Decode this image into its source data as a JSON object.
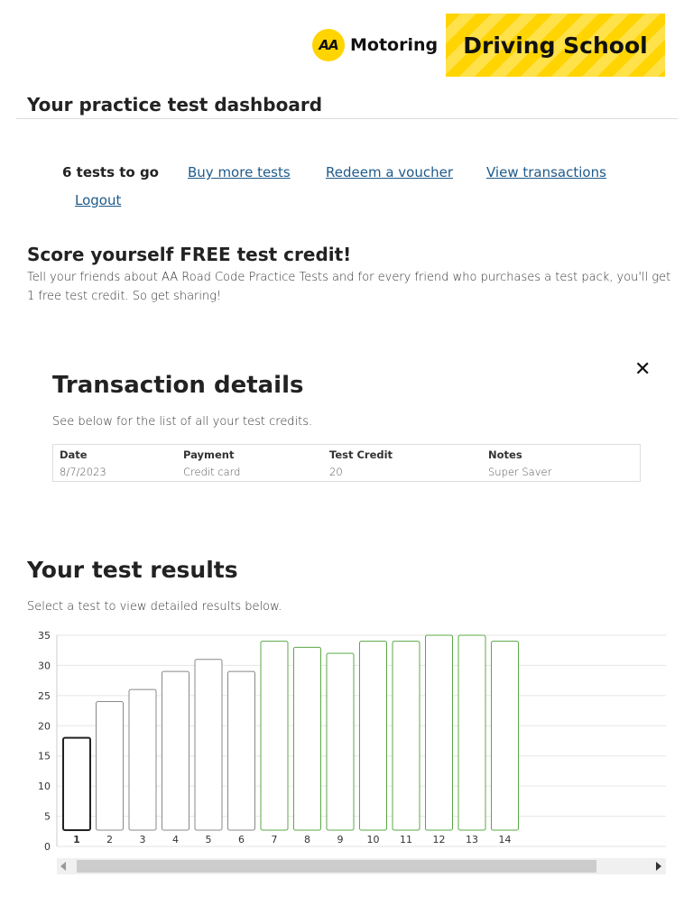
{
  "header": {
    "aa_badge": "AA",
    "aa_word": "Motoring",
    "banner": "Driving School",
    "brand_yellow": "#ffd400"
  },
  "dashboard": {
    "title": "Your practice test dashboard",
    "tests_left": "6 tests to go",
    "links": {
      "buy": "Buy more tests",
      "redeem": "Redeem a voucher",
      "transactions": "View transactions",
      "logout": "Logout"
    }
  },
  "credit": {
    "title": "Score yourself FREE test credit!",
    "description": "Tell your friends about AA Road Code Practice Tests and for every friend who purchases a test pack, you'll get 1 free test credit. So get sharing!"
  },
  "transactions": {
    "title": "Transaction details",
    "close_icon": "close-icon",
    "description": "See below for the list of all your test credits.",
    "columns": [
      "Date",
      "Payment",
      "Test Credit",
      "Notes"
    ],
    "rows": [
      [
        "8/7/2023",
        "Credit card",
        "20",
        "Super Saver"
      ]
    ]
  },
  "results": {
    "title": "Your test results",
    "description": "Select a test to view detailed results below."
  },
  "chart_data": {
    "type": "bar",
    "categories": [
      "1",
      "2",
      "3",
      "4",
      "5",
      "6",
      "7",
      "8",
      "9",
      "10",
      "11",
      "12",
      "13",
      "14"
    ],
    "values": [
      18,
      24,
      26,
      29,
      31,
      29,
      34,
      33,
      32,
      34,
      34,
      35,
      35,
      34
    ],
    "pass_threshold": 32,
    "selected_index": 0,
    "ylim": [
      0,
      35
    ],
    "yticks": [
      0,
      5,
      10,
      15,
      20,
      25,
      30,
      35
    ],
    "grid": true,
    "colors": {
      "pass": "#5aa844",
      "fail": "#888888",
      "selected": "#222222"
    }
  }
}
